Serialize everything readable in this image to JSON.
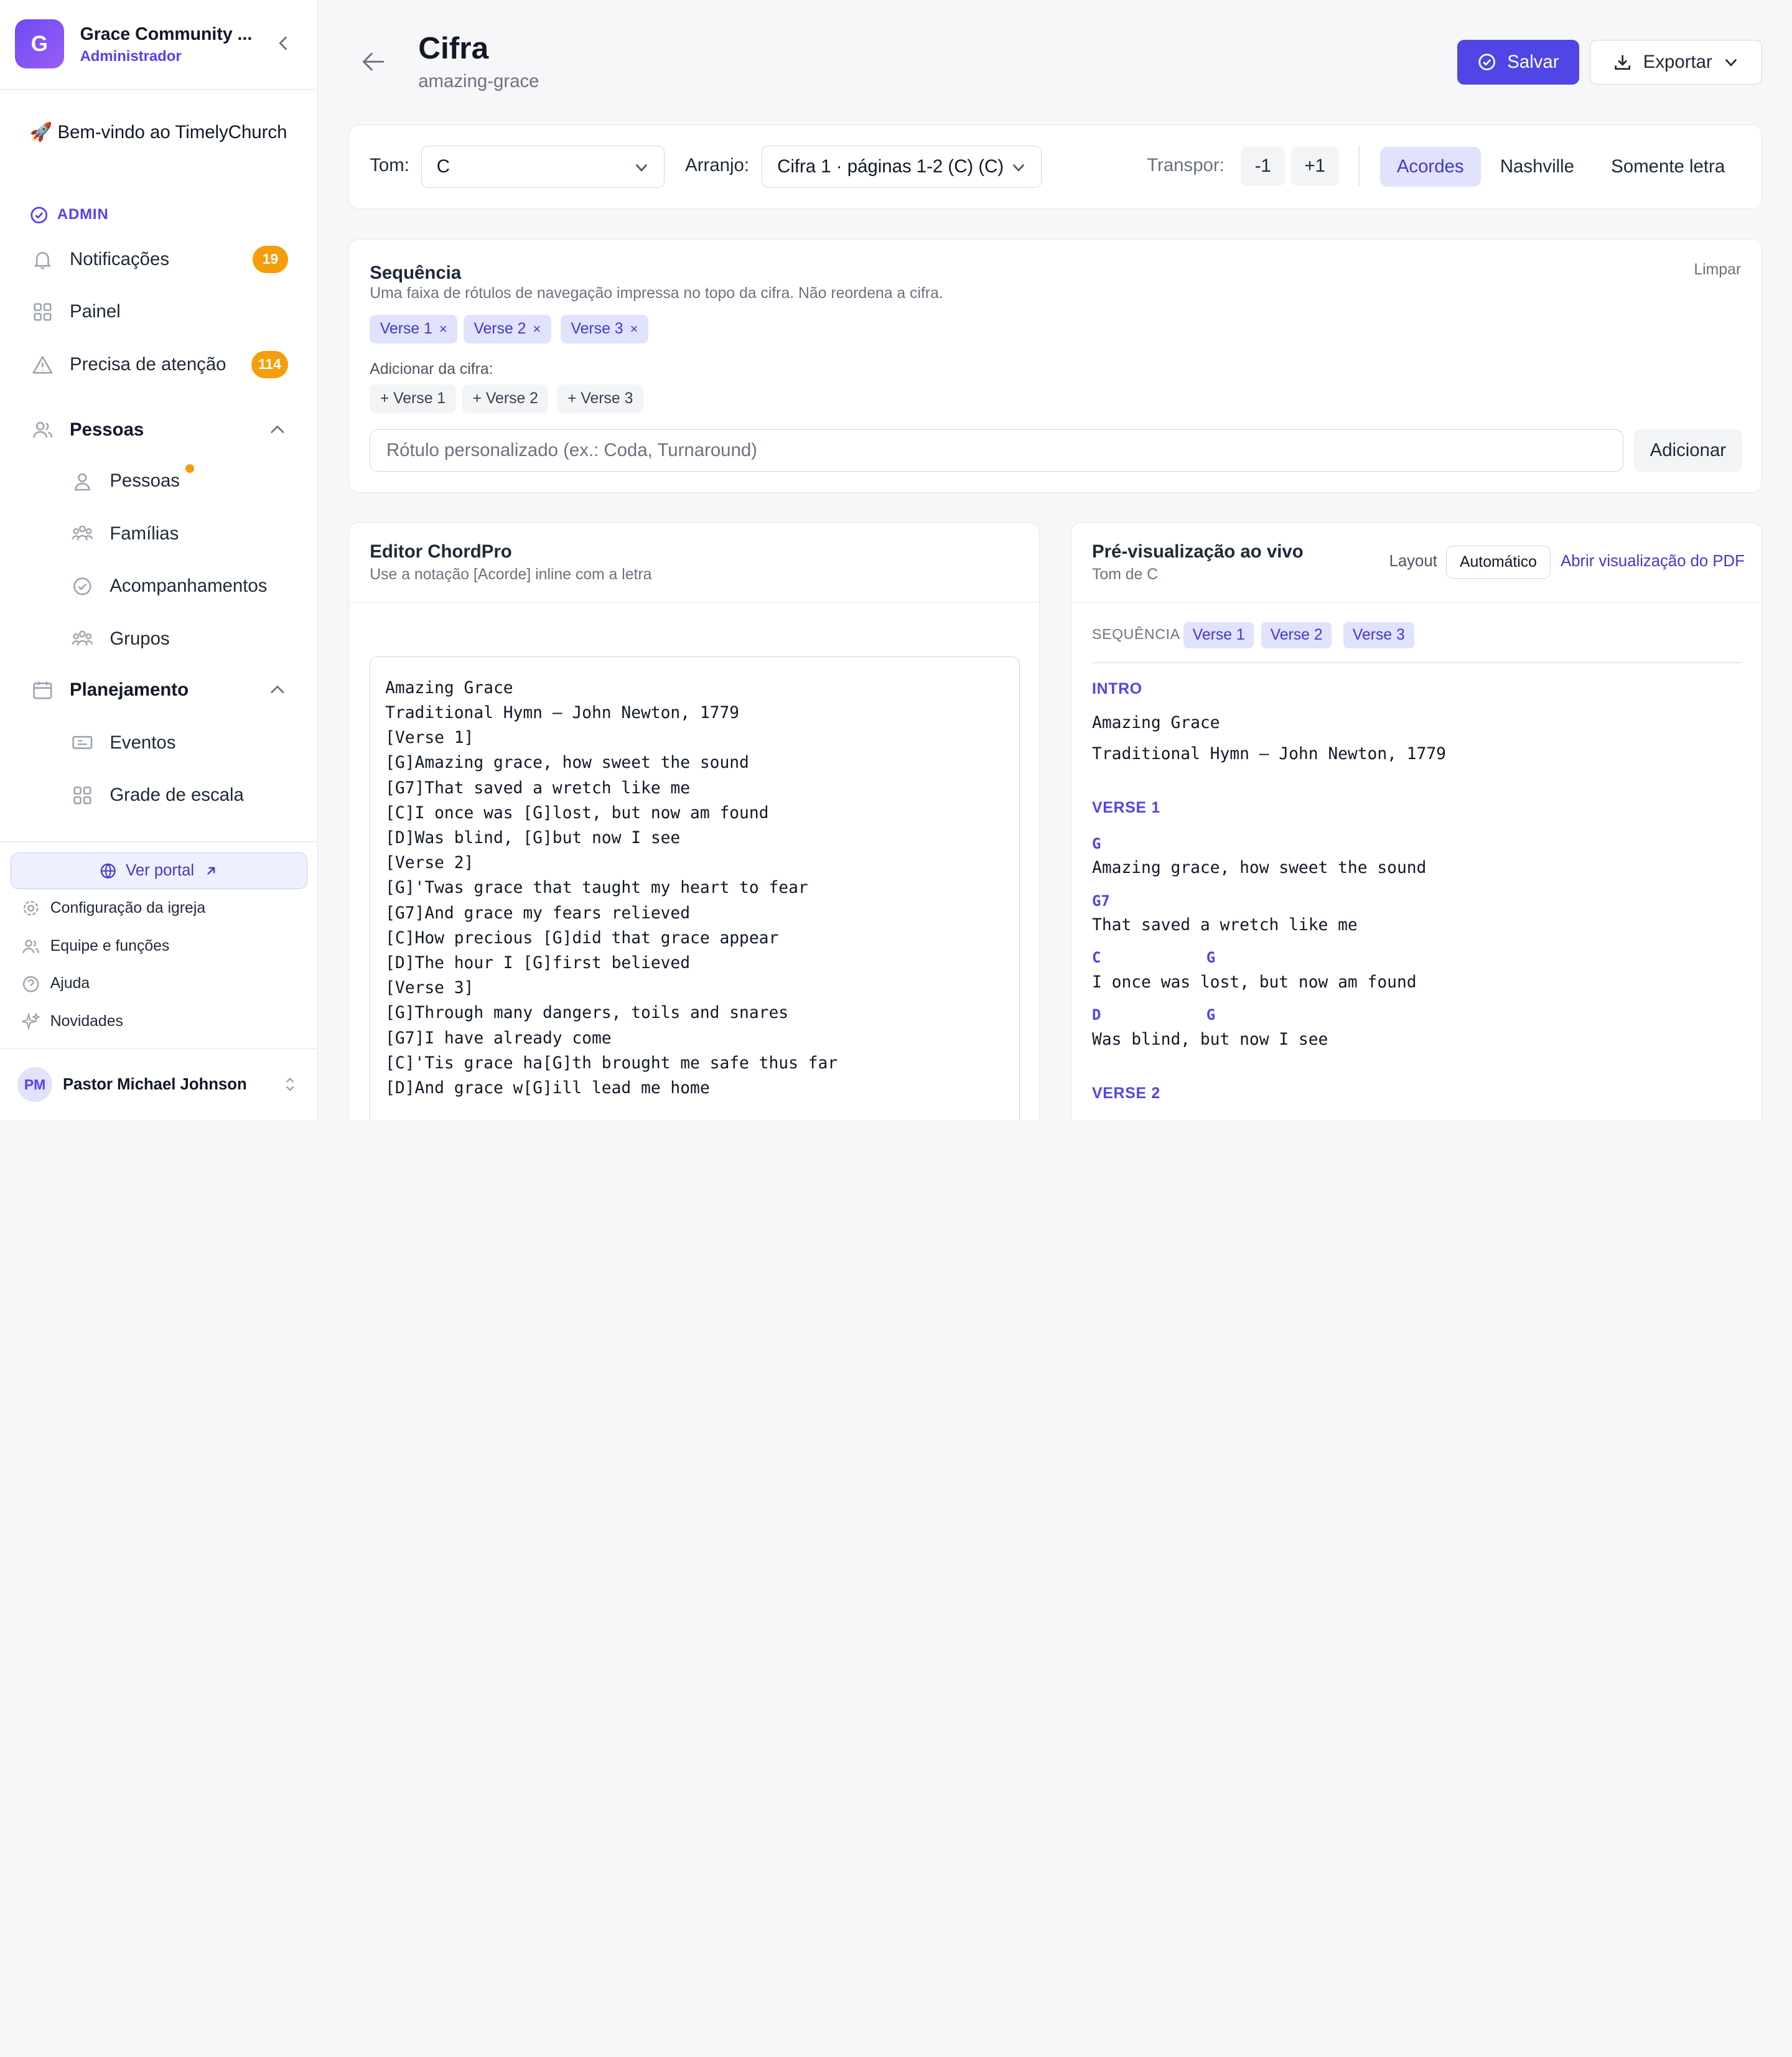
{
  "sidebar": {
    "org_initial": "G",
    "org_name": "Grace Community ...",
    "org_role": "Administrador",
    "welcome": "🚀 Bem-vindo ao TimelyChurch",
    "admin_label": "ADMIN",
    "items": {
      "notifications": {
        "label": "Notificações",
        "badge": "19"
      },
      "dashboard": {
        "label": "Painel"
      },
      "attention": {
        "label": "Precisa de atenção",
        "badge": "114"
      },
      "people_group": {
        "label": "Pessoas"
      },
      "people": {
        "label": "Pessoas"
      },
      "families": {
        "label": "Famílias"
      },
      "followups": {
        "label": "Acompanhamentos"
      },
      "groups": {
        "label": "Grupos"
      },
      "planning_group": {
        "label": "Planejamento"
      },
      "events": {
        "label": "Eventos"
      },
      "schedule": {
        "label": "Grade de escala"
      }
    },
    "portal_label": "Ver portal",
    "footer": {
      "church_settings": "Configuração da igreja",
      "team_roles": "Equipe e funções",
      "help": "Ajuda",
      "whats_new": "Novidades"
    },
    "user": {
      "initials": "PM",
      "name": "Pastor Michael Johnson"
    }
  },
  "header": {
    "title": "Cifra",
    "subtitle": "amazing-grace",
    "save_label": "Salvar",
    "export_label": "Exportar"
  },
  "toolbar": {
    "key_label": "Tom:",
    "key_value": "C",
    "arrangement_label": "Arranjo:",
    "arrangement_value": "Cifra 1 · páginas 1-2 (C) (C)",
    "transpose_label": "Transpor:",
    "minus_label": "-1",
    "plus_label": "+1",
    "modes": {
      "chords": "Acordes",
      "nashville": "Nashville",
      "lyrics_only": "Somente letra"
    },
    "active_mode": "chords"
  },
  "sequence": {
    "title": "Sequência",
    "description": "Uma faixa de rótulos de navegação impressa no topo da cifra. Não reordena a cifra.",
    "clear_label": "Limpar",
    "chips": [
      "Verse 1",
      "Verse 2",
      "Verse 3"
    ],
    "add_from_label": "Adicionar da cifra:",
    "add_options": [
      "+ Verse 1",
      "+ Verse 2",
      "+ Verse 3"
    ],
    "custom_placeholder": "Rótulo personalizado (ex.: Coda, Turnaround)",
    "add_button": "Adicionar"
  },
  "editor": {
    "title": "Editor ChordPro",
    "description": "Use a notação [Acorde] inline com a letra",
    "lines": [
      "Amazing Grace",
      "Traditional Hymn — John Newton, 1779",
      "[Verse 1]",
      "[G]Amazing grace, how sweet the sound",
      "[G7]That saved a wretch like me",
      "[C]I once was [G]lost, but now am found",
      "[D]Was blind, [G]but now I see",
      "[Verse 2]",
      "[G]'Twas grace that taught my heart to fear",
      "[G7]And grace my fears relieved",
      "[C]How precious [G]did that grace appear",
      "[D]The hour I [G]first believed",
      "[Verse 3]",
      "[G]Through many dangers, toils and snares",
      "[G7]I have already come",
      "[C]'Tis grace ha[G]th brought me safe thus far",
      "[D]And grace w[G]ill lead me home"
    ]
  },
  "preview": {
    "title": "Pré-visualização ao vivo",
    "subtitle": "Tom de C",
    "layout_label": "Layout",
    "layout_value": "Automático",
    "pdf_link": "Abrir visualização do PDF",
    "sequence_label": "SEQUÊNCIA",
    "sequence_chips": [
      "Verse 1",
      "Verse 2",
      "Verse 3"
    ],
    "intro_head": "INTRO",
    "intro_lines": [
      "Amazing Grace",
      "Traditional Hymn — John Newton, 1779"
    ],
    "verse1_head": "VERSE 1",
    "verse1": [
      {
        "chords": [
          "G"
        ],
        "lyric": "Amazing grace, how sweet the sound"
      },
      {
        "chords": [
          "G7"
        ],
        "lyric": "That saved a wretch like me"
      },
      {
        "chords": [
          "C",
          "G"
        ],
        "lyric": "I once was lost, but now am found"
      },
      {
        "chords": [
          "D",
          "G"
        ],
        "lyric": "Was blind, but now I see"
      }
    ],
    "verse2_head": "VERSE 2"
  }
}
